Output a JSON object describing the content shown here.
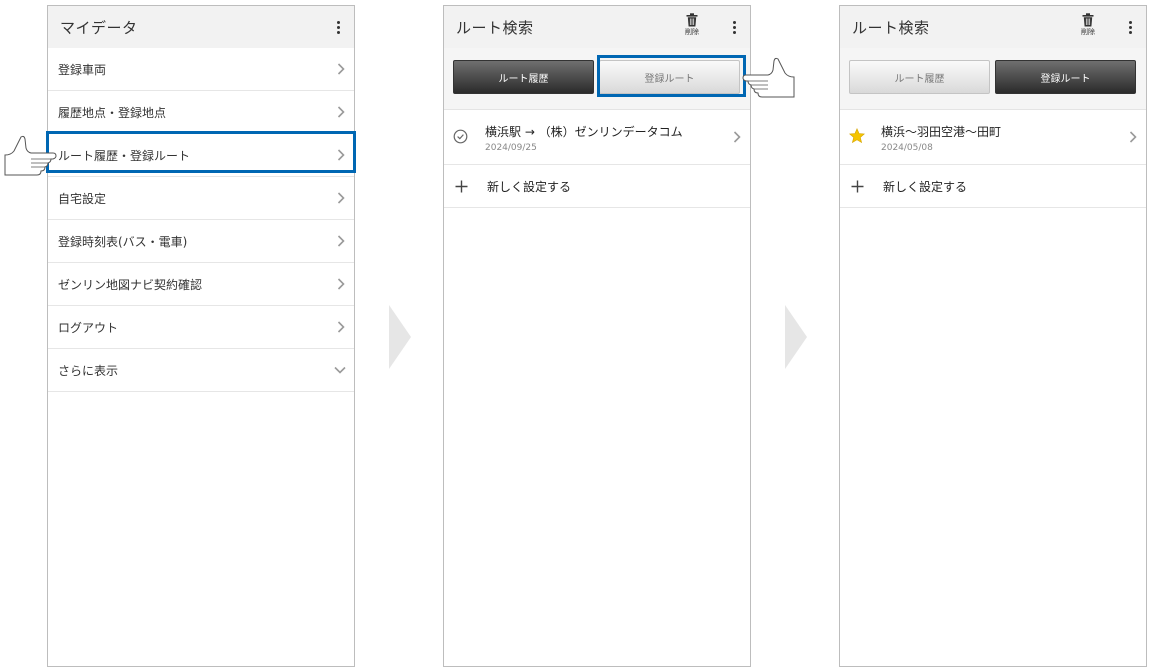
{
  "screen1": {
    "title": "マイデータ",
    "menu": [
      {
        "label": "登録車両"
      },
      {
        "label": "履歴地点・登録地点"
      },
      {
        "label": "ルート履歴・登録ルート"
      },
      {
        "label": "自宅設定"
      },
      {
        "label": "登録時刻表(バス・電車)"
      },
      {
        "label": "ゼンリン地図ナビ契約確認"
      },
      {
        "label": "ログアウト"
      },
      {
        "label": "さらに表示"
      }
    ]
  },
  "screen2": {
    "title": "ルート検索",
    "delete_label": "削除",
    "tabs": [
      {
        "label": "ルート履歴"
      },
      {
        "label": "登録ルート"
      }
    ],
    "route": {
      "title": "横浜駅 → （株）ゼンリンデータコム",
      "date": "2024/09/25"
    },
    "add_label": "新しく設定する"
  },
  "screen3": {
    "title": "ルート検索",
    "delete_label": "削除",
    "tabs": [
      {
        "label": "ルート履歴"
      },
      {
        "label": "登録ルート"
      }
    ],
    "route": {
      "title": "横浜〜羽田空港〜田町",
      "date": "2024/05/08"
    },
    "add_label": "新しく設定する"
  },
  "colors": {
    "highlight": "#0067b3",
    "star": "#f5c400"
  }
}
